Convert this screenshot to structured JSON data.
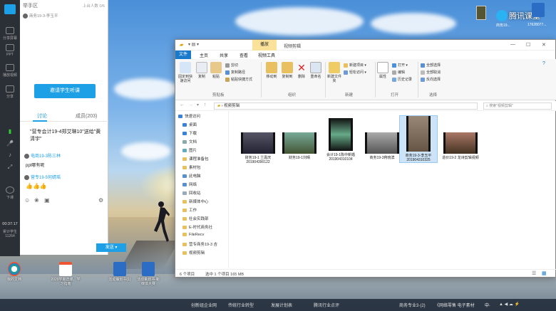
{
  "classroom_panel": {
    "title": "举手区",
    "status": "上台人数 0/6",
    "student": "商务19-3-李玉平",
    "invite_button": "邀请学生听课",
    "tab_discuss": "讨论",
    "tab_members": "成员(203)",
    "messages": [
      {
        "text": "\"营专会计19-4郑艾琳10\"送给\"黄清宇\"",
        "author": ""
      },
      {
        "author": "电商19-3陈三林",
        "text": "ppt哪有呢"
      },
      {
        "author": "营专19-5何婧瑶",
        "text": "👍👍👍"
      }
    ],
    "send_button": "发送"
  },
  "left_toolbar": {
    "items": [
      "分享屏幕",
      "PPT",
      "播放视频",
      "分享",
      "下课"
    ],
    "timer": "00:37:17",
    "attendance": "累计学生",
    "count": "11264"
  },
  "explorer": {
    "context_tab": "播放",
    "window_title": "视频剪辑",
    "ribbon_tabs": [
      "文件",
      "主页",
      "共享",
      "查看",
      "视频工具"
    ],
    "ribbon_groups": [
      "剪贴板",
      "组织",
      "新建",
      "打开",
      "选择"
    ],
    "ribbon_buttons": {
      "pin": "固定到快速访问",
      "copy": "复制",
      "paste": "粘贴",
      "cut": "剪切",
      "copy_path": "复制路径",
      "paste_shortcut": "粘贴快捷方式",
      "move_to": "移动到",
      "copy_to": "复制到",
      "delete": "删除",
      "rename": "重命名",
      "new_folder": "新建文件夹",
      "new_item": "新建项目",
      "easy_access": "轻松访问",
      "properties": "属性",
      "open": "打开",
      "edit": "编辑",
      "history": "历史记录",
      "select_all": "全部选择",
      "select_none": "全部取消",
      "invert": "反向选择"
    },
    "path": "视频剪辑",
    "search_placeholder": "搜索\"视频剪辑\"",
    "nav_items": [
      "快速访问",
      "桌面",
      "下载",
      "文档",
      "图片",
      "课程准备包",
      "素材包",
      "此电脑",
      "网络",
      "回收站",
      "新媒体中心",
      "工作",
      "社会实践部",
      "E-时代商务社",
      "FileRecv",
      "营专商务19-3 吉",
      "视频剪辑"
    ],
    "files": [
      {
        "name": "财务19-1 兰嘉庆201904390122"
      },
      {
        "name": "财务19-1刘晴"
      },
      {
        "name": "会计19-1陈中新婚201904310104"
      },
      {
        "name": "商务19-3蒋晓滨"
      },
      {
        "name": "商务19-3-李玉平201904310325"
      },
      {
        "name": "造价19-2 龙诗剪辑视频"
      }
    ],
    "status_count": "6 个项目",
    "status_selection": "选中 1 个项目  165 MB"
  },
  "desktop_icons": [
    "我的文档",
    "2020学期选课，学习指南",
    "活动策划书(1)",
    "活动策划书-新媒体大赛"
  ],
  "tencent": {
    "label": "腾讯课堂",
    "user": "商务19...",
    "id": "17628077..."
  },
  "taskbar": {
    "time": "",
    "items": [
      "创新组企业网",
      "传统行业转型",
      "发展计划表",
      "腾讯行业点评",
      "商务专业3·(2)",
      "《网络零售 电子素材"
    ]
  },
  "colors": {
    "accent": "#1ea0e6",
    "file_tab": "#1979ca",
    "context_tab": "#fbe29a"
  }
}
